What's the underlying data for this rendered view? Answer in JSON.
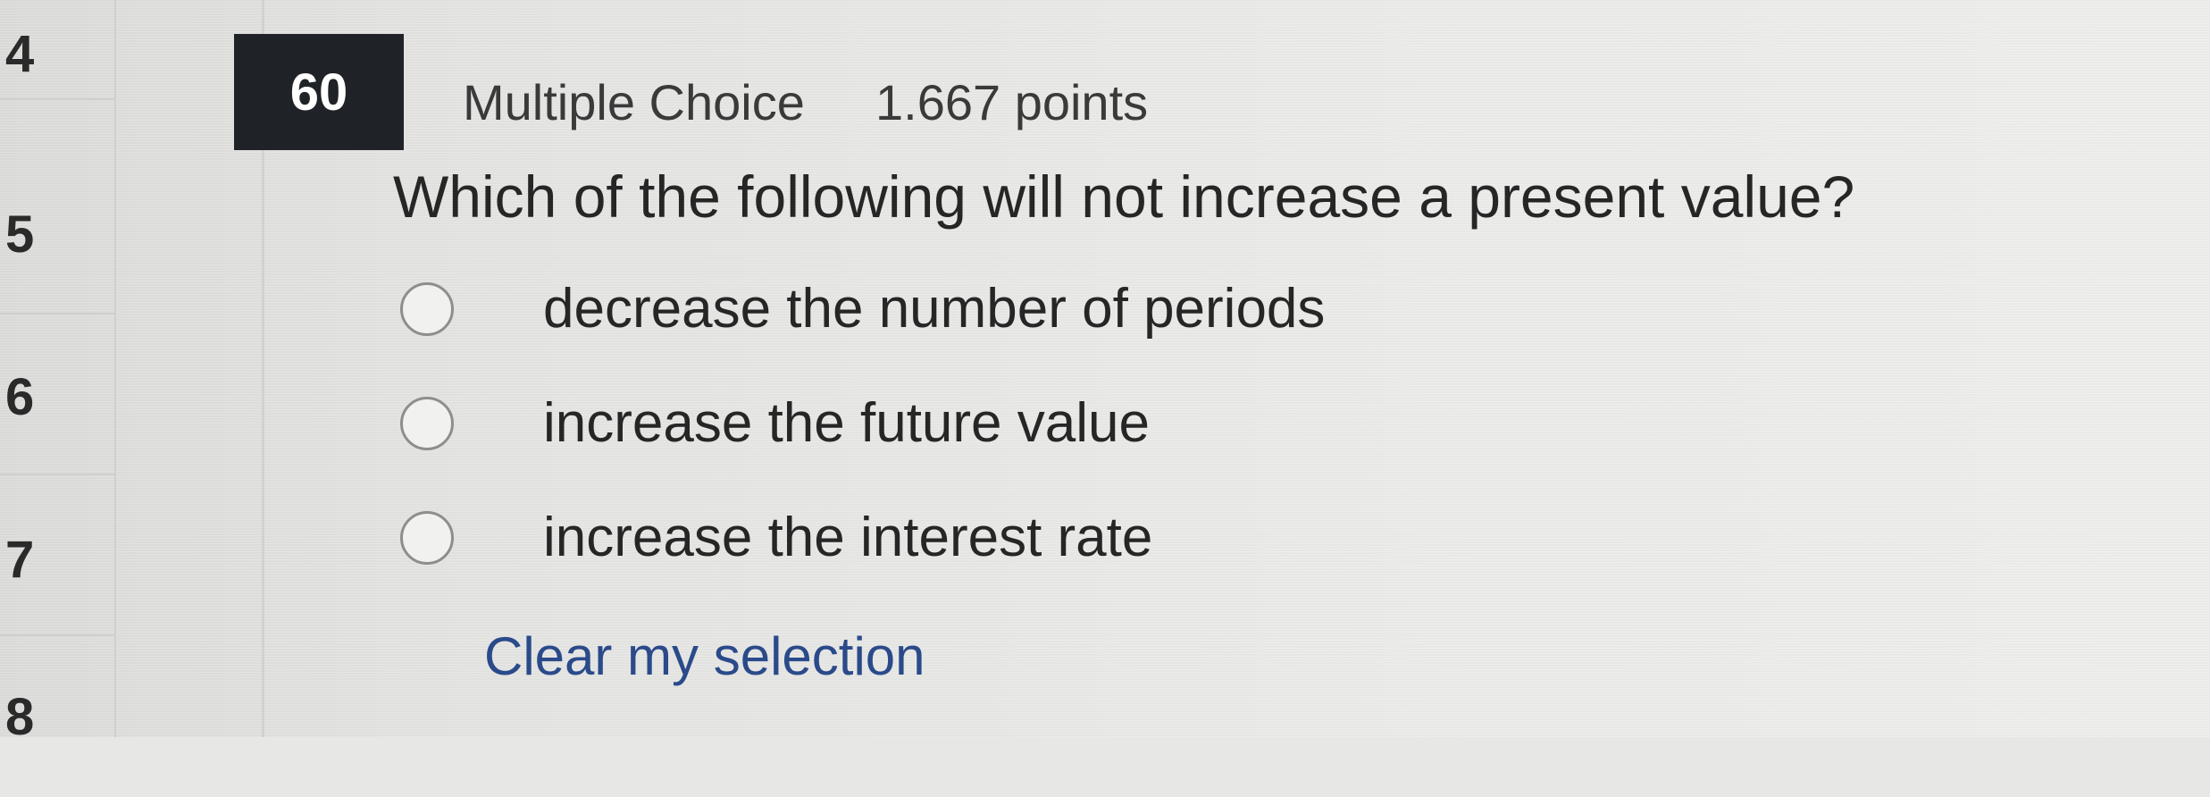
{
  "question_nav": {
    "items": [
      {
        "label": "4"
      },
      {
        "label": "5"
      },
      {
        "label": "6"
      },
      {
        "label": "7"
      },
      {
        "label": "8"
      }
    ]
  },
  "question": {
    "number": "60",
    "type": "Multiple Choice",
    "points": "1.667 points",
    "prompt": "Which of the following will not increase a present value?",
    "options": [
      {
        "label": "decrease the number of periods",
        "selected": false
      },
      {
        "label": "increase the future value",
        "selected": false
      },
      {
        "label": "increase the interest rate",
        "selected": false
      }
    ],
    "clear_label": "Clear my selection"
  }
}
